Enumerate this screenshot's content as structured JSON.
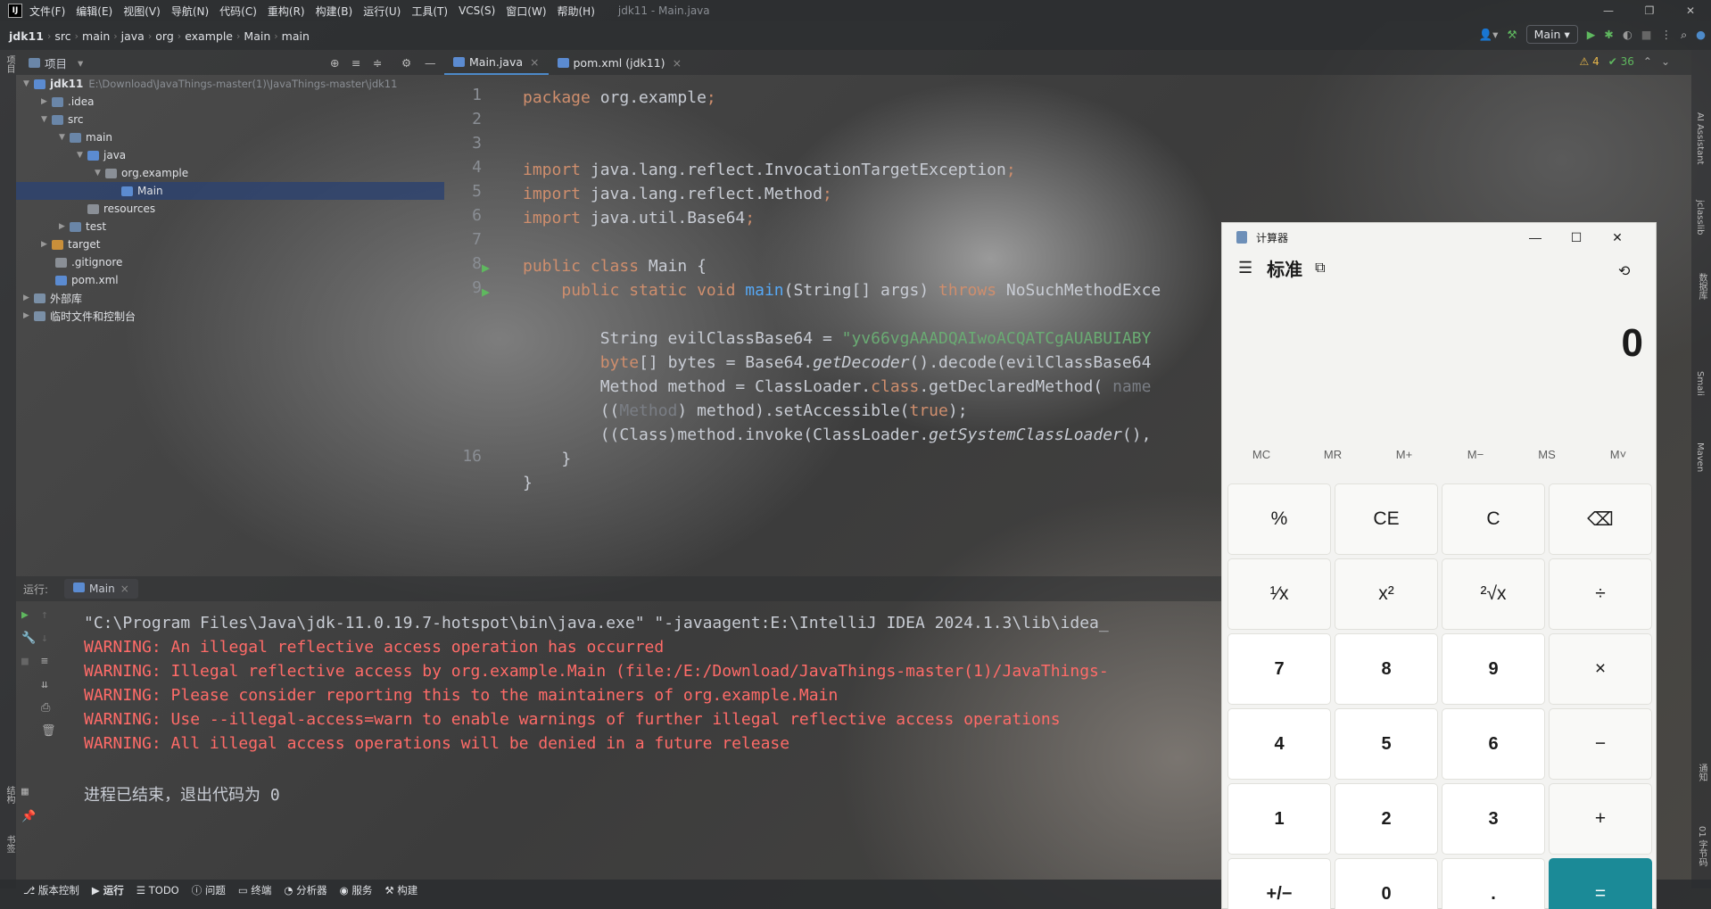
{
  "menubar": {
    "items": [
      "文件(F)",
      "编辑(E)",
      "视图(V)",
      "导航(N)",
      "代码(C)",
      "重构(R)",
      "构建(B)",
      "运行(U)",
      "工具(T)",
      "VCS(S)",
      "窗口(W)",
      "帮助(H)"
    ],
    "window_title": "jdk11 - Main.java"
  },
  "nav": {
    "crumbs": [
      "jdk11",
      "src",
      "main",
      "java",
      "org",
      "example",
      "Main",
      "main"
    ],
    "run_config": "Main"
  },
  "project": {
    "title": "项目",
    "tree": [
      {
        "label": "jdk11",
        "extra": "E:\\Download\\JavaThings-master(1)\\JavaThings-master\\jdk11",
        "depth": 0,
        "icon": "folder-icon"
      },
      {
        "label": ".idea",
        "depth": 1,
        "icon": "folder-icon"
      },
      {
        "label": "src",
        "depth": 1,
        "icon": "folder-icon"
      },
      {
        "label": "main",
        "depth": 2,
        "icon": "folder-icon"
      },
      {
        "label": "java",
        "depth": 3,
        "icon": "source-folder-icon"
      },
      {
        "label": "org.example",
        "depth": 4,
        "icon": "package-icon"
      },
      {
        "label": "Main",
        "depth": 5,
        "icon": "class-icon"
      },
      {
        "label": "resources",
        "depth": 3,
        "icon": "resources-folder-icon"
      },
      {
        "label": "test",
        "depth": 2,
        "icon": "folder-icon"
      },
      {
        "label": "target",
        "depth": 1,
        "icon": "target-folder-icon"
      },
      {
        "label": ".gitignore",
        "depth": 1,
        "icon": "file-icon"
      },
      {
        "label": "pom.xml",
        "depth": 1,
        "icon": "maven-file-icon"
      },
      {
        "label": "外部库",
        "depth": 0,
        "icon": "library-icon"
      },
      {
        "label": "临时文件和控制台",
        "depth": 0,
        "icon": "scratch-icon"
      }
    ]
  },
  "editor": {
    "tabs": [
      "Main.java",
      "pom.xml (jdk11)"
    ],
    "inspection": {
      "warnings": "4",
      "ok": "36"
    },
    "line_numbers": [
      "1",
      "2",
      "3",
      "4",
      "5",
      "6",
      "7",
      "8",
      "9",
      "",
      "",
      "",
      "",
      "",
      "",
      "16",
      ""
    ],
    "lines": [
      [
        [
          "kw",
          "package "
        ],
        [
          "cls",
          "org.example"
        ],
        [
          "kw",
          ";"
        ]
      ],
      [],
      [],
      [
        [
          "kw",
          "import "
        ],
        [
          "cls",
          "java.lang.reflect.InvocationTargetException"
        ],
        [
          "kw",
          ";"
        ]
      ],
      [
        [
          "kw",
          "import "
        ],
        [
          "cls",
          "java.lang.reflect.Method"
        ],
        [
          "kw",
          ";"
        ]
      ],
      [
        [
          "kw",
          "import "
        ],
        [
          "cls",
          "java.util.Base64"
        ],
        [
          "kw",
          ";"
        ]
      ],
      [],
      [
        [
          "kw",
          "public class "
        ],
        [
          "cls",
          "Main {"
        ]
      ],
      [
        [
          "cls",
          "    "
        ],
        [
          "kw",
          "public static void "
        ],
        [
          "fn",
          "main"
        ],
        [
          "cls",
          "(String[] args) "
        ],
        [
          "kw",
          "throws "
        ],
        [
          "cls",
          "NoSuchMethodExce"
        ]
      ],
      [],
      [
        [
          "cls",
          "        String evilClassBase64 = "
        ],
        [
          "str",
          "\"yv66vgAAADQAIwoACQATCgAUABUIABY"
        ]
      ],
      [
        [
          "cls",
          "        "
        ],
        [
          "kw",
          "byte"
        ],
        [
          "cls",
          "[] bytes = Base64."
        ],
        [
          "it",
          "getDecoder"
        ],
        [
          "cls",
          "().decode(evilClassBase64"
        ]
      ],
      [
        [
          "cls",
          "        Method method = ClassLoader."
        ],
        [
          "kw",
          "class"
        ],
        [
          "cls",
          ".getDeclaredMethod( "
        ],
        [
          "par",
          "name"
        ]
      ],
      [
        [
          "cls",
          "        (("
        ],
        [
          "par",
          "Method"
        ],
        [
          "cls",
          ") method).setAccessible("
        ],
        [
          "kw",
          "true"
        ],
        [
          "cls",
          ");"
        ]
      ],
      [
        [
          "cls",
          "        ((Class)method.invoke(ClassLoader."
        ],
        [
          "it",
          "getSystemClassLoader"
        ],
        [
          "cls",
          "(),"
        ]
      ],
      [
        [
          "cls",
          "    }"
        ]
      ],
      [
        [
          "cls",
          "}"
        ]
      ]
    ]
  },
  "run": {
    "label": "运行:",
    "tab": "Main",
    "lines": [
      {
        "t": "\"C:\\Program Files\\Java\\jdk-11.0.19.7-hotspot\\bin\\java.exe\" \"-javaagent:E:\\IntelliJ IDEA 2024.1.3\\lib\\idea_",
        "c": "cmd"
      },
      {
        "t": "WARNING: An illegal reflective access operation has occurred",
        "c": "warn"
      },
      {
        "t": "WARNING: Illegal reflective access by org.example.Main (file:/E:/Download/JavaThings-master(1)/JavaThings-",
        "c": "warn"
      },
      {
        "t": "WARNING: Please consider reporting this to the maintainers of org.example.Main",
        "c": "warn"
      },
      {
        "t": "WARNING: Use --illegal-access=warn to enable warnings of further illegal reflective access operations",
        "c": "warn"
      },
      {
        "t": "WARNING: All illegal access operations will be denied in a future release",
        "c": "warn"
      },
      {
        "t": "",
        "c": "cmd"
      },
      {
        "t": "进程已结束，退出代码为 0",
        "c": "cmd"
      }
    ]
  },
  "bottom_tabs": [
    "版本控制",
    "运行",
    "TODO",
    "问题",
    "终端",
    "分析器",
    "服务",
    "构建"
  ],
  "left_strip": [
    "项目",
    "结构",
    "书签"
  ],
  "right_strip": [
    "AI Assistant",
    "jclasslib",
    "数据库",
    "Smali",
    "Maven",
    "通知",
    "01 字节码"
  ],
  "calculator": {
    "title": "计算器",
    "mode": "标准",
    "display": "0",
    "memory": [
      "MC",
      "MR",
      "M+",
      "M−",
      "MS",
      "M˅"
    ],
    "keys": [
      [
        "%",
        "CE",
        "C",
        "⌫"
      ],
      [
        "¹⁄x",
        "x²",
        "²√x",
        "÷"
      ],
      [
        "7",
        "8",
        "9",
        "×"
      ],
      [
        "4",
        "5",
        "6",
        "−"
      ],
      [
        "1",
        "2",
        "3",
        "+"
      ],
      [
        "+/−",
        "0",
        ".",
        "="
      ]
    ]
  },
  "colors": {
    "accent": "#4d8ac9",
    "calc_equals": "#1b8a97",
    "warning": "#ff6b68"
  }
}
